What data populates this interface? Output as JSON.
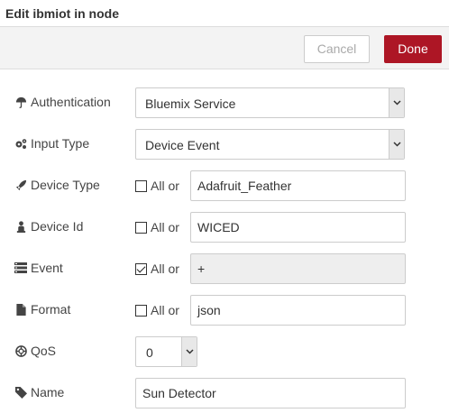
{
  "dialog": {
    "title": "Edit ibmiot in node"
  },
  "toolbar": {
    "cancel_label": "Cancel",
    "done_label": "Done"
  },
  "fields": {
    "authentication": {
      "label": "Authentication",
      "value": "Bluemix Service",
      "icon": "umbrella-icon"
    },
    "input_type": {
      "label": "Input Type",
      "value": "Device Event",
      "icon": "cogs-icon"
    },
    "device_type": {
      "label": "Device Type",
      "all_label": "All or",
      "all_checked": false,
      "value": "Adafruit_Feather",
      "icon": "rocket-icon"
    },
    "device_id": {
      "label": "Device Id",
      "all_label": "All or",
      "all_checked": false,
      "value": "WICED",
      "icon": "user-icon"
    },
    "event": {
      "label": "Event",
      "all_label": "All or",
      "all_checked": true,
      "value": "+",
      "icon": "list-icon"
    },
    "format": {
      "label": "Format",
      "all_label": "All or",
      "all_checked": false,
      "value": "json",
      "icon": "file-icon"
    },
    "qos": {
      "label": "QoS",
      "value": "0",
      "icon": "life-ring-icon"
    },
    "name": {
      "label": "Name",
      "value": "Sun Detector",
      "icon": "tag-icon"
    }
  }
}
